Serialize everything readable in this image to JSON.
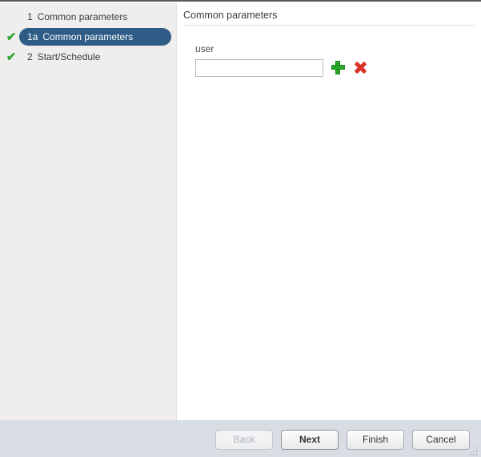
{
  "sidebar": {
    "steps": [
      {
        "check": "",
        "number": "1",
        "label": "Common parameters",
        "selected": false,
        "checked": false
      },
      {
        "check": "✔",
        "number": "1a",
        "label": "Common parameters",
        "selected": true,
        "checked": true
      },
      {
        "check": "✔",
        "number": "2",
        "label": "Start/Schedule",
        "selected": false,
        "checked": true
      }
    ]
  },
  "main": {
    "title": "Common parameters",
    "field": {
      "label": "user",
      "value": "",
      "placeholder": "",
      "add_icon": "plus-icon",
      "remove_icon": "x-icon"
    }
  },
  "footer": {
    "buttons": [
      {
        "label": "Back",
        "state": "disabled"
      },
      {
        "label": "Next",
        "state": "default"
      },
      {
        "label": "Finish",
        "state": "normal"
      },
      {
        "label": "Cancel",
        "state": "normal"
      }
    ],
    "resize_grip_icon": "resize-grip-icon"
  },
  "colors": {
    "selected_step_bg": "#2e5c86",
    "check_green": "#33a532",
    "plus_green": "#28a428",
    "x_red": "#d8342a",
    "sidebar_bg": "#efeeed",
    "footer_bg": "#d8dce3"
  }
}
